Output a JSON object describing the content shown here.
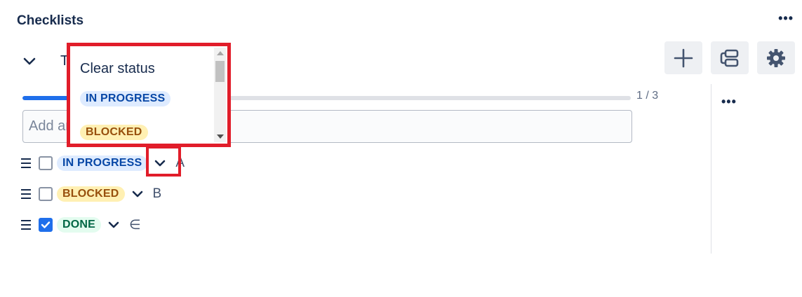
{
  "header": {
    "title": "Checklists",
    "more_icon": "more-horizontal-icon",
    "more_label": "•••"
  },
  "toolbar": {
    "collapse_icon": "chevron-down-icon",
    "truncated_title": "T",
    "add_icon": "plus-icon",
    "template_icon": "template-stack-icon",
    "settings_icon": "gear-icon"
  },
  "progress": {
    "done": 1,
    "total": 3,
    "label": "1 / 3",
    "color": "#1f6feb"
  },
  "add_item": {
    "placeholder": "Add an item"
  },
  "sidebar": {
    "more_label": "•••"
  },
  "items": [
    {
      "status": "IN PROGRESS",
      "text": "A",
      "checked": false
    },
    {
      "status": "BLOCKED",
      "text": "B",
      "checked": false
    },
    {
      "status": "DONE",
      "text": "∈",
      "checked": true
    }
  ],
  "status_dropdown": {
    "options": [
      {
        "label": "Clear status"
      },
      {
        "label": "IN PROGRESS"
      },
      {
        "label": "BLOCKED"
      }
    ]
  },
  "colors": {
    "highlight": "#e11d2a",
    "in_progress_bg": "#deebff",
    "in_progress_fg": "#0747a6",
    "blocked_bg": "#fff0b3",
    "blocked_fg": "#974f0c",
    "done_bg": "#e3fcef",
    "done_fg": "#006644"
  }
}
